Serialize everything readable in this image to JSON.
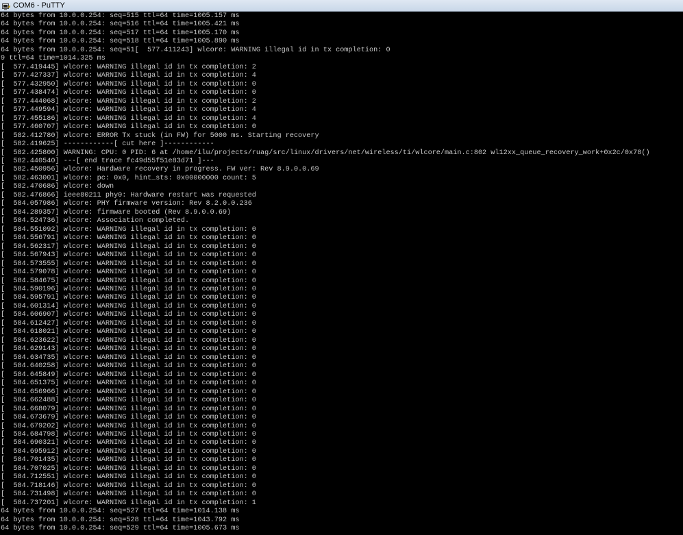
{
  "window": {
    "title": "COM6 - PuTTY",
    "icon": "putty-terminal-icon"
  },
  "colors": {
    "terminal_background": "#000000",
    "terminal_foreground": "#c8c8c8"
  },
  "terminal": {
    "lines": [
      "64 bytes from 10.0.0.254: seq=515 ttl=64 time=1005.157 ms",
      "64 bytes from 10.0.0.254: seq=516 ttl=64 time=1005.421 ms",
      "64 bytes from 10.0.0.254: seq=517 ttl=64 time=1005.170 ms",
      "64 bytes from 10.0.0.254: seq=518 ttl=64 time=1005.890 ms",
      "64 bytes from 10.0.0.254: seq=51[  577.411243] wlcore: WARNING illegal id in tx completion: 0",
      "9 ttl=64 time=1014.325 ms",
      "[  577.419445] wlcore: WARNING illegal id in tx completion: 2",
      "[  577.427337] wlcore: WARNING illegal id in tx completion: 4",
      "[  577.432950] wlcore: WARNING illegal id in tx completion: 0",
      "[  577.438474] wlcore: WARNING illegal id in tx completion: 0",
      "[  577.444068] wlcore: WARNING illegal id in tx completion: 2",
      "[  577.449594] wlcore: WARNING illegal id in tx completion: 4",
      "[  577.455186] wlcore: WARNING illegal id in tx completion: 4",
      "[  577.460707] wlcore: WARNING illegal id in tx completion: 0",
      "[  582.412780] wlcore: ERROR Tx stuck (in FW) for 5000 ms. Starting recovery",
      "[  582.419625] ------------[ cut here ]------------",
      "[  582.425800] WARNING: CPU: 0 PID: 6 at /home/ilu/projects/ruag/src/linux/drivers/net/wireless/ti/wlcore/main.c:802 wl12xx_queue_recovery_work+0x2c/0x78()",
      "[  582.440540] ---[ end trace fc49d55f51e83d71 ]---",
      "[  582.450956] wlcore: Hardware recovery in progress. FW ver: Rev 8.9.0.0.69",
      "[  582.463001] wlcore: pc: 0x0, hint_sts: 0x00000000 count: 5",
      "[  582.470686] wlcore: down",
      "[  582.476866] ieee80211 phy0: Hardware restart was requested",
      "[  584.057986] wlcore: PHY firmware version: Rev 8.2.0.0.236",
      "[  584.289357] wlcore: firmware booted (Rev 8.9.0.0.69)",
      "[  584.524736] wlcore: Association completed.",
      "[  584.551092] wlcore: WARNING illegal id in tx completion: 0",
      "[  584.556791] wlcore: WARNING illegal id in tx completion: 0",
      "[  584.562317] wlcore: WARNING illegal id in tx completion: 0",
      "[  584.567943] wlcore: WARNING illegal id in tx completion: 0",
      "[  584.573555] wlcore: WARNING illegal id in tx completion: 0",
      "[  584.579078] wlcore: WARNING illegal id in tx completion: 0",
      "[  584.584675] wlcore: WARNING illegal id in tx completion: 0",
      "[  584.590196] wlcore: WARNING illegal id in tx completion: 0",
      "[  584.595791] wlcore: WARNING illegal id in tx completion: 0",
      "[  584.601314] wlcore: WARNING illegal id in tx completion: 0",
      "[  584.606907] wlcore: WARNING illegal id in tx completion: 0",
      "[  584.612427] wlcore: WARNING illegal id in tx completion: 0",
      "[  584.618021] wlcore: WARNING illegal id in tx completion: 0",
      "[  584.623622] wlcore: WARNING illegal id in tx completion: 0",
      "[  584.629143] wlcore: WARNING illegal id in tx completion: 0",
      "[  584.634735] wlcore: WARNING illegal id in tx completion: 0",
      "[  584.640258] wlcore: WARNING illegal id in tx completion: 0",
      "[  584.645849] wlcore: WARNING illegal id in tx completion: 0",
      "[  584.651375] wlcore: WARNING illegal id in tx completion: 0",
      "[  584.656966] wlcore: WARNING illegal id in tx completion: 0",
      "[  584.662488] wlcore: WARNING illegal id in tx completion: 0",
      "[  584.668079] wlcore: WARNING illegal id in tx completion: 0",
      "[  584.673679] wlcore: WARNING illegal id in tx completion: 0",
      "[  584.679202] wlcore: WARNING illegal id in tx completion: 0",
      "[  584.684798] wlcore: WARNING illegal id in tx completion: 0",
      "[  584.690321] wlcore: WARNING illegal id in tx completion: 0",
      "[  584.695912] wlcore: WARNING illegal id in tx completion: 0",
      "[  584.701435] wlcore: WARNING illegal id in tx completion: 0",
      "[  584.707025] wlcore: WARNING illegal id in tx completion: 0",
      "[  584.712551] wlcore: WARNING illegal id in tx completion: 0",
      "[  584.718146] wlcore: WARNING illegal id in tx completion: 0",
      "[  584.731498] wlcore: WARNING illegal id in tx completion: 0",
      "[  584.737201] wlcore: WARNING illegal id in tx completion: 1",
      "64 bytes from 10.0.0.254: seq=527 ttl=64 time=1014.138 ms",
      "64 bytes from 10.0.0.254: seq=528 ttl=64 time=1043.792 ms",
      "64 bytes from 10.0.0.254: seq=529 ttl=64 time=1005.673 ms"
    ]
  }
}
